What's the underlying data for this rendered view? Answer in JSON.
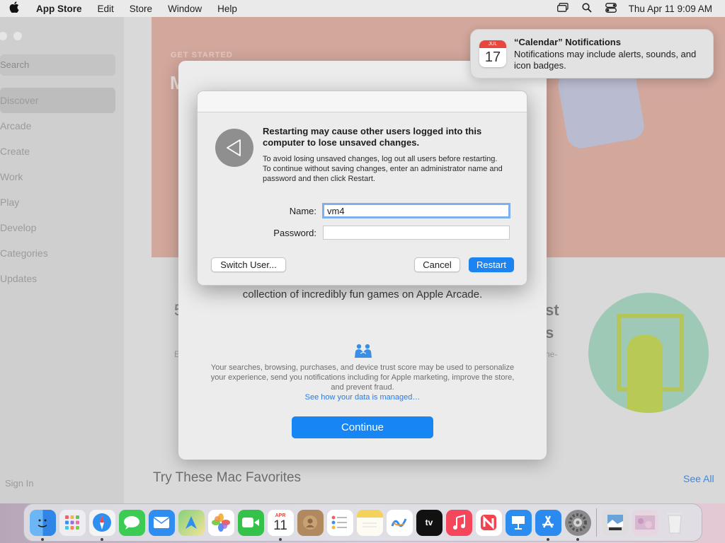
{
  "menubar": {
    "apple": "",
    "app_name": "App Store",
    "menus": [
      "Edit",
      "Store",
      "Window",
      "Help"
    ],
    "clock": "Thu Apr 11  9:09 AM"
  },
  "sidebar": {
    "search_placeholder": "Search",
    "items": [
      "Discover",
      "Arcade",
      "Create",
      "Work",
      "Play",
      "Develop",
      "Categories",
      "Updates"
    ],
    "sign_in": "Sign In"
  },
  "hero": {
    "eyebrow": "GET STARTED",
    "title_fragment": "M"
  },
  "welcome_sheet": {
    "games_text": "collection of incredibly fun games on Apple Arcade.",
    "privacy_text": "Your searches, browsing, purchases, and device trust score may be used to personalize your experience, send you notifications including for Apple marketing, improve the store, and prevent fraud.",
    "privacy_link": "See how your data is managed…",
    "continue_label": "Continue"
  },
  "background": {
    "number_fragment": "5",
    "right_title_1": "st",
    "right_title_2": "s",
    "small_left": "E",
    "small_right": "ne-",
    "try_title": "Try These Mac Favorites",
    "see_all": "See All"
  },
  "dialog": {
    "headline": "Restarting may cause other users logged into this computer to lose unsaved changes.",
    "body": "To avoid losing unsaved changes, log out all users before restarting. To continue without saving changes, enter an administrator name and password and then click Restart.",
    "name_label": "Name:",
    "name_value": "vm4",
    "password_label": "Password:",
    "password_value": "",
    "switch_user": "Switch User...",
    "cancel": "Cancel",
    "restart": "Restart"
  },
  "notification": {
    "title": "“Calendar” Notifications",
    "text": "Notifications may include alerts, sounds, and icon badges.",
    "cal_month": "JUL",
    "cal_day": "17"
  },
  "dock": {
    "apps": [
      {
        "name": "finder",
        "color": "#3a8ee6",
        "glyph": "☺"
      },
      {
        "name": "launchpad",
        "color": "#e9e9ee",
        "glyph": ""
      },
      {
        "name": "safari",
        "color": "#2f89e8",
        "glyph": "⊕"
      },
      {
        "name": "messages",
        "color": "#37c84f",
        "glyph": ""
      },
      {
        "name": "mail",
        "color": "#2f8cf0",
        "glyph": "✉"
      },
      {
        "name": "maps",
        "color": "#6fbf6a",
        "glyph": ""
      },
      {
        "name": "photos",
        "color": "#f7f7f7",
        "glyph": ""
      },
      {
        "name": "facetime",
        "color": "#35c24b",
        "glyph": ""
      },
      {
        "name": "calendar",
        "color": "#ffffff",
        "glyph": ""
      },
      {
        "name": "contacts",
        "color": "#b08a5e",
        "glyph": ""
      },
      {
        "name": "reminders",
        "color": "#f7f7f7",
        "glyph": ""
      },
      {
        "name": "notes",
        "color": "#f4d25b",
        "glyph": ""
      },
      {
        "name": "freeform",
        "color": "#f7f7f7",
        "glyph": ""
      },
      {
        "name": "apple-tv",
        "color": "#111111",
        "glyph": "tv"
      },
      {
        "name": "music",
        "color": "#f4475b",
        "glyph": "♫"
      },
      {
        "name": "news",
        "color": "#f04450",
        "glyph": "N"
      },
      {
        "name": "keynote",
        "color": "#2b8df0",
        "glyph": ""
      },
      {
        "name": "app-store",
        "color": "#2b8af0",
        "glyph": "A"
      },
      {
        "name": "system-settings",
        "color": "#8a8a8a",
        "glyph": "⚙"
      }
    ],
    "calendar_month": "APR",
    "calendar_day": "11"
  }
}
